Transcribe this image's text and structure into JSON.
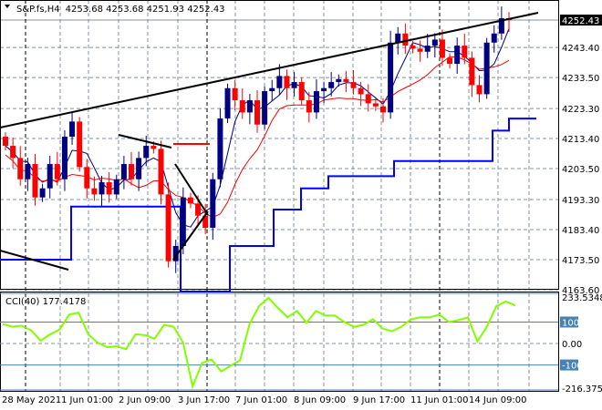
{
  "header": {
    "symbol": "S&P.fs,H4",
    "ohlc": "4253.68 4253.68 4251.93 4252.43"
  },
  "chart_data": [
    {
      "type": "candlestick",
      "title": "S&P.fs,H4",
      "closes": [
        4211,
        4207,
        4200,
        4205,
        4194,
        4197,
        4205,
        4200,
        4214,
        4219,
        4204,
        4197,
        4195,
        4199,
        4195,
        4200,
        4205,
        4200,
        4207,
        4211,
        4210,
        4195,
        4173,
        4178,
        4194,
        4192,
        4188,
        4184,
        4200,
        4220,
        4230,
        4226,
        4222,
        4226,
        4218,
        4229,
        4230,
        4234,
        4230,
        4232,
        4226,
        4222,
        4229,
        4230,
        4232,
        4233,
        4232,
        4230,
        4228,
        4225,
        4224,
        4222,
        4245,
        4248,
        4244,
        4243,
        4242,
        4244,
        4246,
        4240,
        4238,
        4244,
        4240,
        4231,
        4228,
        4245,
        4248,
        4253,
        4252.43
      ],
      "first_open": 4214,
      "y_ticks": [
        "4243.40",
        "4233.50",
        "4223.30",
        "4213.40",
        "4203.50",
        "4193.30",
        "4183.40",
        "4173.50",
        "4163.60"
      ],
      "ylim": [
        4163.6,
        4252.43
      ],
      "last_price": "4252.43",
      "step_line": [
        [
          0,
          4173.5
        ],
        [
          0.13,
          4191
        ],
        [
          0.33,
          4163
        ],
        [
          0.42,
          4178
        ],
        [
          0.5,
          4190
        ],
        [
          0.55,
          4197
        ],
        [
          0.6,
          4201
        ],
        [
          0.72,
          4206
        ],
        [
          0.9,
          4216
        ],
        [
          0.93,
          4220
        ],
        [
          0.98,
          4220
        ]
      ],
      "colors": {
        "bull": "#000080",
        "bear": "#ff0000",
        "ma_fast": "#000080",
        "ma_slow": "#ff0000",
        "step": "#0000ff",
        "trend": "#000000"
      }
    },
    {
      "type": "line",
      "title": "CCI(40)",
      "label": "CCI(40) 177.4178",
      "values": [
        91,
        78,
        83,
        61,
        13,
        43,
        65,
        135,
        144,
        43,
        4,
        -17,
        -13,
        -26,
        43,
        39,
        22,
        87,
        78,
        4,
        -200,
        -91,
        -74,
        -130,
        -104,
        -78,
        91,
        174,
        213,
        165,
        122,
        152,
        96,
        152,
        130,
        130,
        100,
        78,
        87,
        113,
        70,
        57,
        78,
        113,
        122,
        122,
        135,
        100,
        109,
        122,
        9,
        78,
        174,
        196,
        177
      ],
      "levels": [
        "100",
        "0.00",
        "-100"
      ],
      "max_label": "233.5348",
      "min_label": "-216.3753",
      "ylim": [
        -216.3753,
        233.5348
      ],
      "color": "#80ff00"
    }
  ],
  "x_labels": [
    "28 May 2021",
    "1 Jun 01:00",
    "2 Jun 09:00",
    "3 Jun 17:00",
    "7 Jun 01:00",
    "8 Jun 09:00",
    "9 Jun 17:00",
    "11 Jun 01:00",
    "14 Jun 09:00"
  ]
}
